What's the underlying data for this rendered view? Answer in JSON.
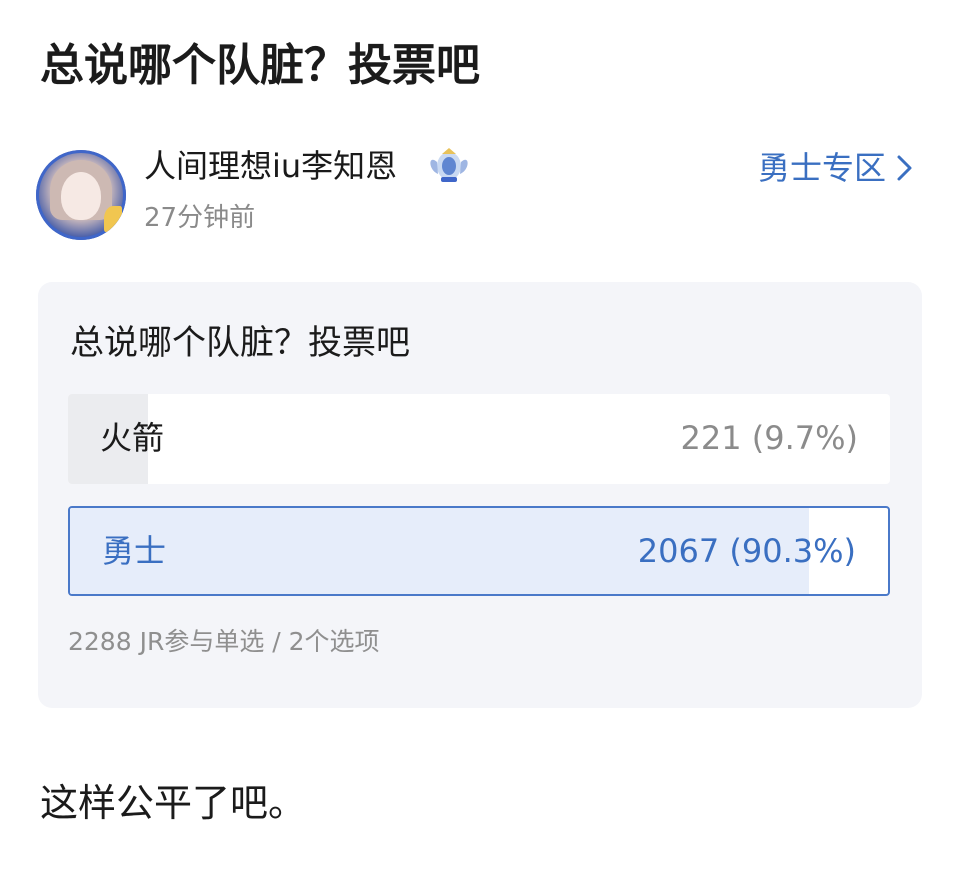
{
  "post": {
    "title": "总说哪个队脏？投票吧",
    "body": "这样公平了吧。"
  },
  "author": {
    "name": "人间理想iu李知恩",
    "time": "27分钟前",
    "avatar_icon": "avatar-image",
    "badge_icon": "winged-badge-icon"
  },
  "zone": {
    "label": "勇士专区",
    "icon": "chevron-right-icon"
  },
  "poll": {
    "question": "总说哪个队脏？投票吧",
    "options": [
      {
        "label": "火箭",
        "result": "221 (9.7%)",
        "fraction": 0.097,
        "selected": false
      },
      {
        "label": "勇士",
        "result": "2067 (90.3%)",
        "fraction": 0.903,
        "selected": true
      }
    ],
    "meta": "2288 JR参与单选 / 2个选项"
  },
  "colors": {
    "accent": "#3a6fc1",
    "selected_border": "#4a79c9",
    "selected_fill": "#e6edfa",
    "unselected_fill": "#ebecef",
    "card_bg": "#f4f5f9",
    "muted_text": "#8b8b8b"
  }
}
